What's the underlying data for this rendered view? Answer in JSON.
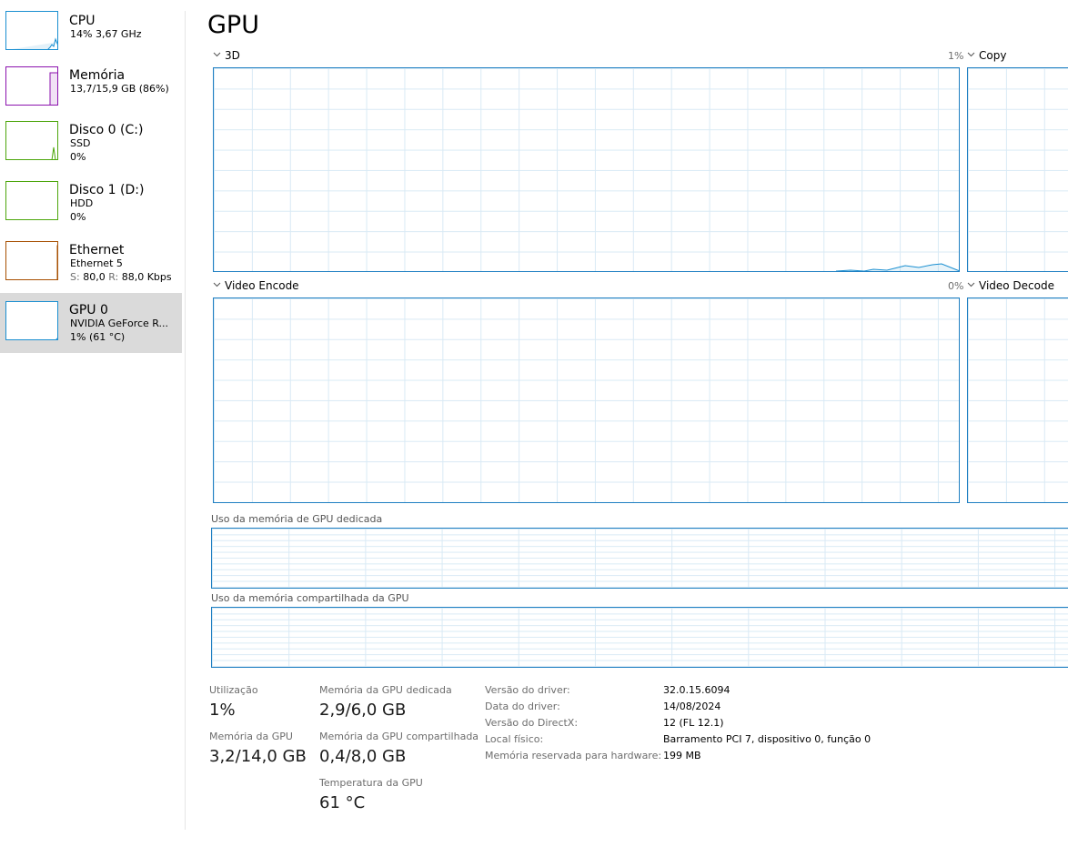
{
  "sidebar": {
    "items": [
      {
        "title": "CPU",
        "sub1": "14% 3,67 GHz",
        "color": "#1a8fd1",
        "selected": false
      },
      {
        "title": "Memória",
        "sub1": "13,7/15,9 GB (86%)",
        "color": "#8b12ae",
        "selected": false
      },
      {
        "title": "Disco 0 (C:)",
        "sub1": "SSD",
        "sub2": "0%",
        "color": "#4da60c",
        "selected": false
      },
      {
        "title": "Disco 1 (D:)",
        "sub1": "HDD",
        "sub2": "0%",
        "color": "#4da60c",
        "selected": false
      },
      {
        "title": "Ethernet",
        "sub1": "Ethernet 5",
        "sub2_s": "S:",
        "sub2_s_val": "80,0",
        "sub2_r": "R:",
        "sub2_r_val": "88,0 Kbps",
        "color": "#a74f01",
        "selected": false
      },
      {
        "title": "GPU 0",
        "sub1": "NVIDIA GeForce R...",
        "sub2": "1% (61 °C)",
        "color": "#1a8fd1",
        "selected": true
      }
    ]
  },
  "main": {
    "title": "GPU",
    "graphs": {
      "g3d": {
        "label": "3D",
        "pct": "1%"
      },
      "copy": {
        "label": "Copy"
      },
      "video_encode": {
        "label": "Video Encode",
        "pct": "0%"
      },
      "video_decode": {
        "label": "Video Decode"
      }
    },
    "mem_dedicated_label": "Uso da memória de GPU dedicada",
    "mem_shared_label": "Uso da memória compartilhada da GPU"
  },
  "stats": {
    "utilization": {
      "label": "Utilização",
      "value": "1%"
    },
    "gpu_memory": {
      "label": "Memória da GPU",
      "value": "3,2/14,0 GB"
    },
    "dedicated": {
      "label": "Memória da GPU dedicada",
      "value": "2,9/6,0 GB"
    },
    "shared": {
      "label": "Memória da GPU compartilhada",
      "value": "0,4/8,0 GB"
    },
    "temperature": {
      "label": "Temperatura da GPU",
      "value": "61 °C"
    }
  },
  "info": [
    {
      "key": "Versão do driver:",
      "value": "32.0.15.6094"
    },
    {
      "key": "Data do driver:",
      "value": "14/08/2024"
    },
    {
      "key": "Versão do DirectX:",
      "value": "12 (FL 12.1)"
    },
    {
      "key": "Local físico:",
      "value": "Barramento PCI 7, dispositivo 0, função 0"
    },
    {
      "key": "Memória reservada para hardware:",
      "value": "199 MB"
    }
  ]
}
